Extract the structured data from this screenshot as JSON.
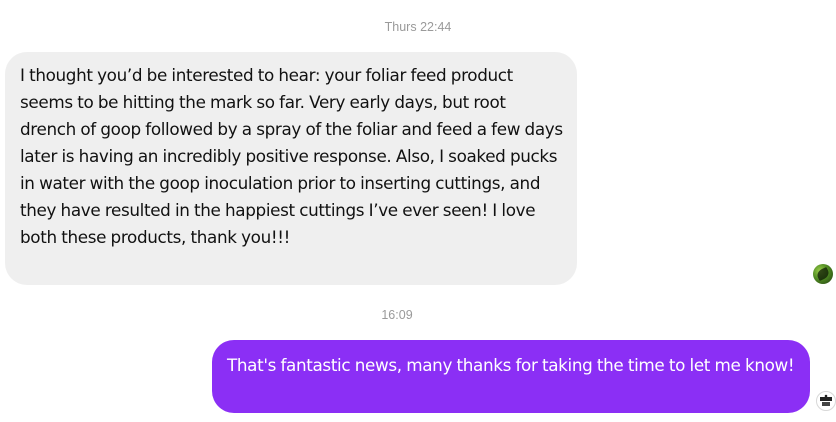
{
  "conversation": {
    "timestamps": [
      "Thurs 22:44",
      "16:09"
    ],
    "incoming": {
      "text": "I thought you’d be interested to hear: your foliar feed product seems to be hitting the mark so far. Very early days, but root drench of goop followed by a spray of the foliar and feed a few days later is having an incredibly positive response. Also, I soaked pucks in water with the goop inoculation prior to inserting cuttings, and they have resulted in the happiest cuttings I’ve ever seen! I love both these products, thank you!!!",
      "avatar_icon": "leaf-avatar-icon",
      "bubble_color": "#efefef"
    },
    "outgoing": {
      "text": "That's fantastic news, many thanks for taking the time to let me know!",
      "avatar_icon": "brand-logo-avatar-icon",
      "bubble_color": "#8b2ff5"
    }
  }
}
